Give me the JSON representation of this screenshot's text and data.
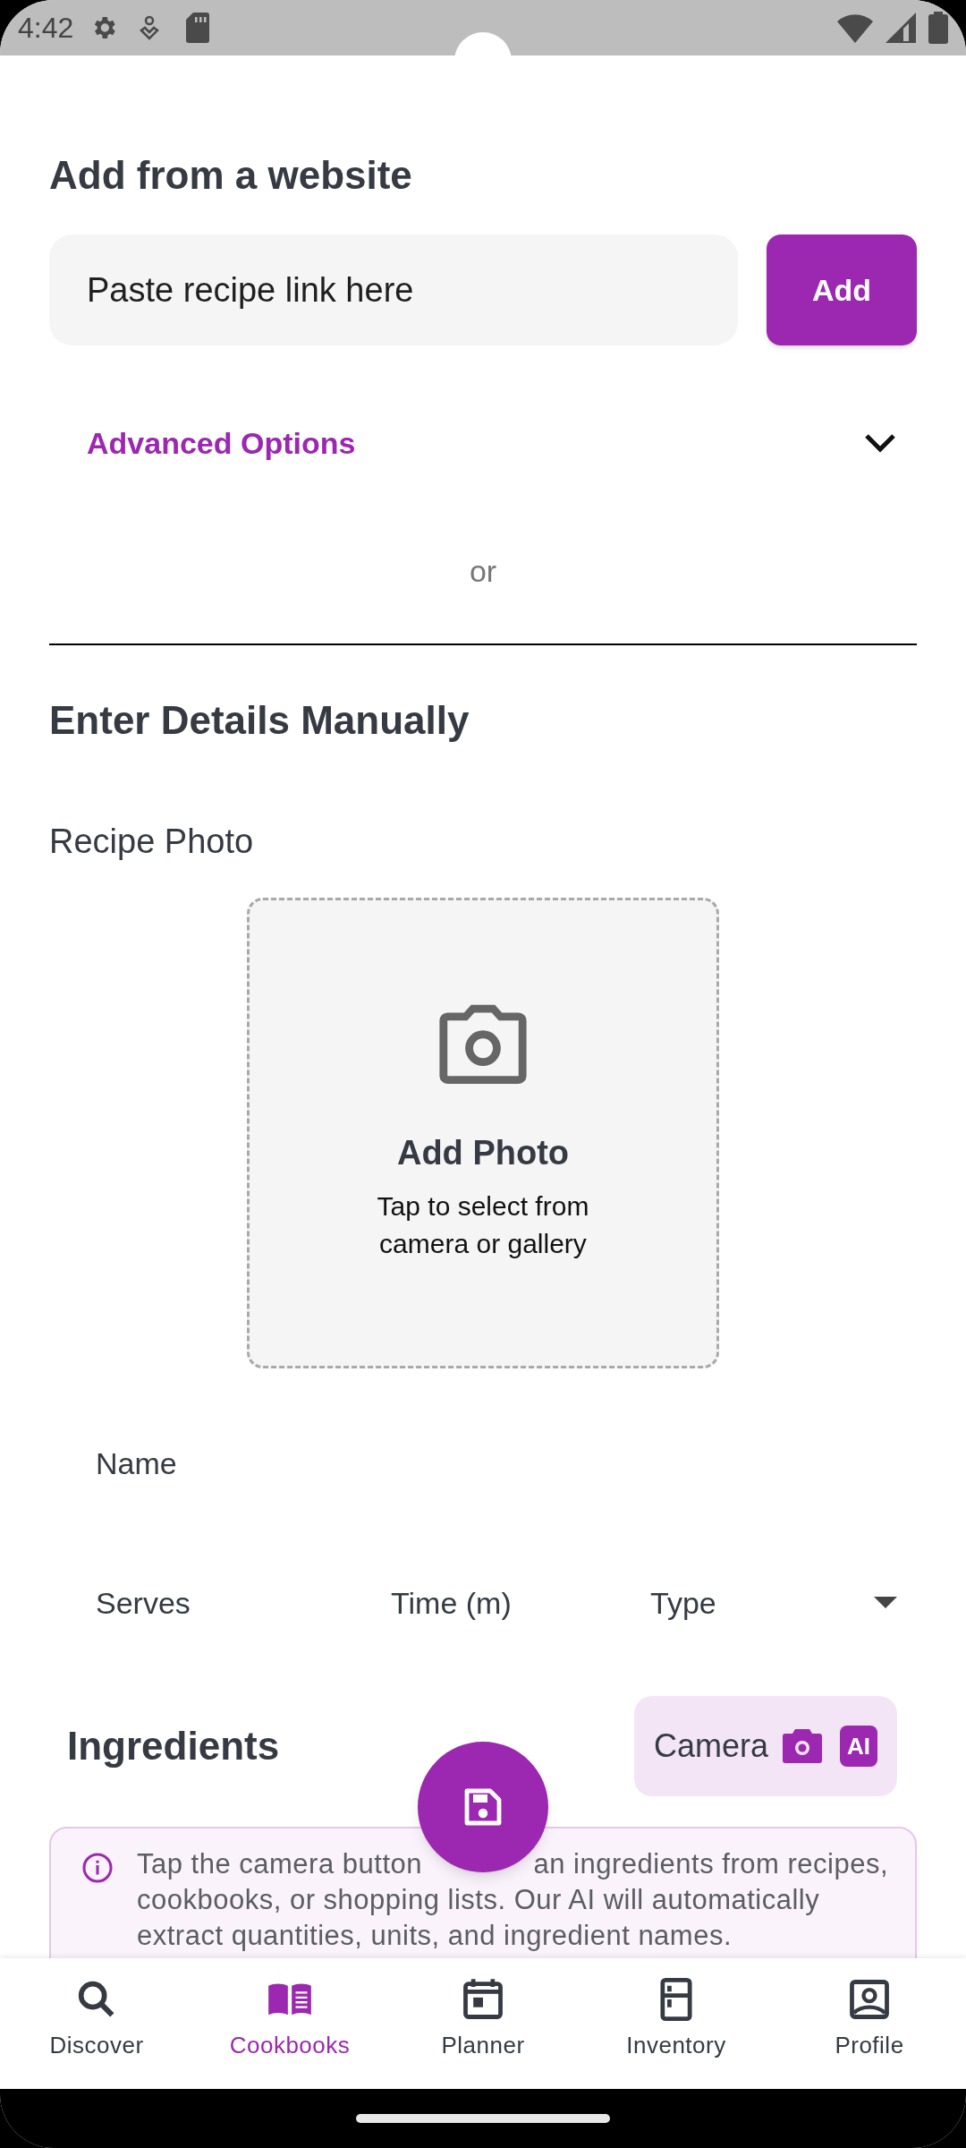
{
  "status_bar": {
    "time": "4:42"
  },
  "website": {
    "title": "Add from a website",
    "placeholder": "Paste recipe link here",
    "add_button": "Add",
    "advanced_options": {
      "label": "Advanced Options",
      "expanded": false
    },
    "separator": "or"
  },
  "manual": {
    "title": "Enter Details Manually",
    "photo_label": "Recipe Photo",
    "photo": {
      "title": "Add Photo",
      "hint": "Tap to select from camera or gallery"
    },
    "fields": [
      {
        "label": "Name",
        "kind": "text"
      }
    ],
    "row_fields": [
      {
        "label": "Serves",
        "kind": "text"
      },
      {
        "label": "Time (m)",
        "kind": "text"
      },
      {
        "label": "Type",
        "kind": "dropdown"
      }
    ]
  },
  "ingredients": {
    "title": "Ingredients",
    "camera_button": "Camera",
    "ai_badge": "AI",
    "info": {
      "line_1_left": "Tap the camera button",
      "line_1_right": "an ingredients from recipes,",
      "rest": "cookbooks, or shopping lists. Our AI will automatically extract quantities, units, and ingredient names."
    }
  },
  "nav": [
    {
      "label": "Discover",
      "selected": false
    },
    {
      "label": "Cookbooks",
      "selected": true
    },
    {
      "label": "Planner",
      "selected": false
    },
    {
      "label": "Inventory",
      "selected": false
    },
    {
      "label": "Profile",
      "selected": false
    }
  ]
}
